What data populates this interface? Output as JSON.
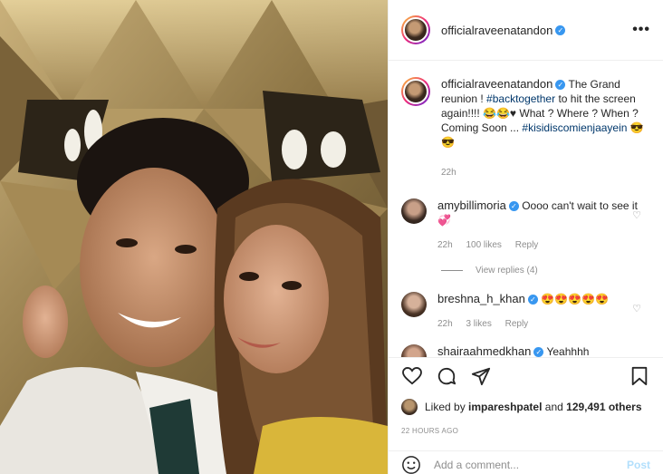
{
  "post": {
    "author": "officialraveenatandon",
    "verified": true,
    "photo_alt": "selfie photo"
  },
  "caption": {
    "author": "officialraveenatandon",
    "text_1": "The Grand reunion ! ",
    "hashtag_1": "#backtogether",
    "text_2": " to hit the screen again!!!! 😂😂♥ What ? Where ? When ? Coming Soon ... ",
    "hashtag_2": "#kisidiscomienjaayein",
    "text_3": " 😎😎",
    "time": "22h"
  },
  "comments": [
    {
      "user": "amybillimoria",
      "text": "Oooo can't wait to see it💞",
      "time": "22h",
      "likes": "100 likes",
      "reply": "Reply"
    },
    {
      "user": "breshna_h_khan",
      "text": "😍😍😍😍😍",
      "time": "22h",
      "likes": "3 likes",
      "reply": "Reply"
    },
    {
      "user": "shairaahmedkhan",
      "text": "Yeahhhh"
    }
  ],
  "view_replies": "View replies (4)",
  "icons": [
    "heart-icon",
    "comment-icon",
    "share-icon",
    "bookmark-icon",
    "emoji-icon",
    "more-icon"
  ],
  "likes": {
    "prefix": "Liked by ",
    "user": "impareshpatel",
    "mid": " and ",
    "count": "129,491 others"
  },
  "age": "22 HOURS AGO",
  "add_comment": {
    "placeholder": "Add a comment...",
    "post_label": "Post"
  },
  "colors": {
    "accent": "#3897f0",
    "link": "#00376b",
    "muted": "#8e8e8e",
    "post_disabled": "#b2dffc"
  }
}
